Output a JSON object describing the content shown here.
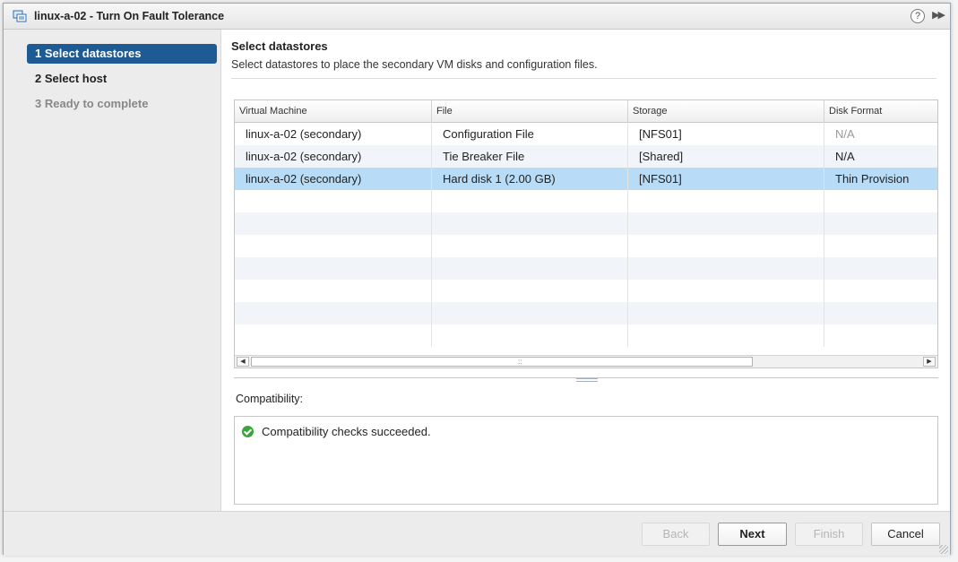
{
  "window": {
    "title": "linux-a-02 - Turn On Fault Tolerance",
    "help_glyph": "?",
    "expand_glyph": "▶▶"
  },
  "steps": [
    {
      "label": "1  Select datastores",
      "state": "active"
    },
    {
      "label": "2  Select host",
      "state": "normal"
    },
    {
      "label": "3  Ready to complete",
      "state": "disabled"
    }
  ],
  "page": {
    "heading": "Select datastores",
    "subheading": "Select datastores to place the secondary VM disks and configuration files."
  },
  "table": {
    "columns": [
      "Virtual Machine",
      "File",
      "Storage",
      "Disk Format"
    ],
    "rows": [
      {
        "vm": "linux-a-02 (secondary)",
        "file": "Configuration File",
        "storage": "[NFS01]",
        "format": "N/A",
        "format_muted": true
      },
      {
        "vm": "linux-a-02 (secondary)",
        "file": "Tie Breaker File",
        "storage": "[Shared]",
        "format": "N/A",
        "format_muted": false
      },
      {
        "vm": "linux-a-02 (secondary)",
        "file": "Hard disk 1 (2.00 GB)",
        "storage": "[NFS01]",
        "format": "Thin Provision",
        "format_muted": false,
        "selected": true
      }
    ],
    "scrollbar_grip": "::"
  },
  "compatibility": {
    "label": "Compatibility:",
    "message": "Compatibility checks succeeded.",
    "status_color": "#3aa53a"
  },
  "buttons": {
    "back": "Back",
    "next": "Next",
    "finish": "Finish",
    "cancel": "Cancel"
  },
  "colors": {
    "active_step": "#1e5a94",
    "selected_row": "#b9dcf6",
    "alt_row": "#f1f5fa"
  }
}
